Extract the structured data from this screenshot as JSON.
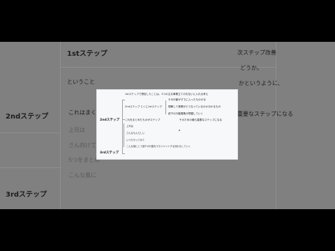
{
  "background": {
    "labels": [
      "1stステップ",
      "次ステップ改善",
      "どうか。",
      "ということ",
      "かというように、",
      "2ndステップ",
      "これはまくし",
      "重要なステップになる",
      "上司は",
      "さん向けて",
      "5つをまとめ",
      "こんな風に",
      "3rdステップ"
    ]
  },
  "card": {
    "top_note": "1stステップで想定したことは、3つの主な事業立てのお互いに入れる考え",
    "left_top_label": "2ndステップ",
    "left_bottom_label": "3rdステップ",
    "branch_upper_label": "2ndステップ とくに1stステップ",
    "upper_items": [
      "その行動がすでに入ったものかな",
      "理解して事業がどうなっているのか分かるもの",
      "部下の行動要素が把握していく"
    ],
    "branch_mid_left": "これをまとめたものがステップ",
    "branch_mid_right": "そのための最も重要なステップになる",
    "mid_items": [
      "上司は",
      "さんなもんだしい",
      "いつもやってみて",
      "こんな風にして部下の行動をマネジメントする流れをしていく"
    ],
    "mid_marker": "b"
  }
}
